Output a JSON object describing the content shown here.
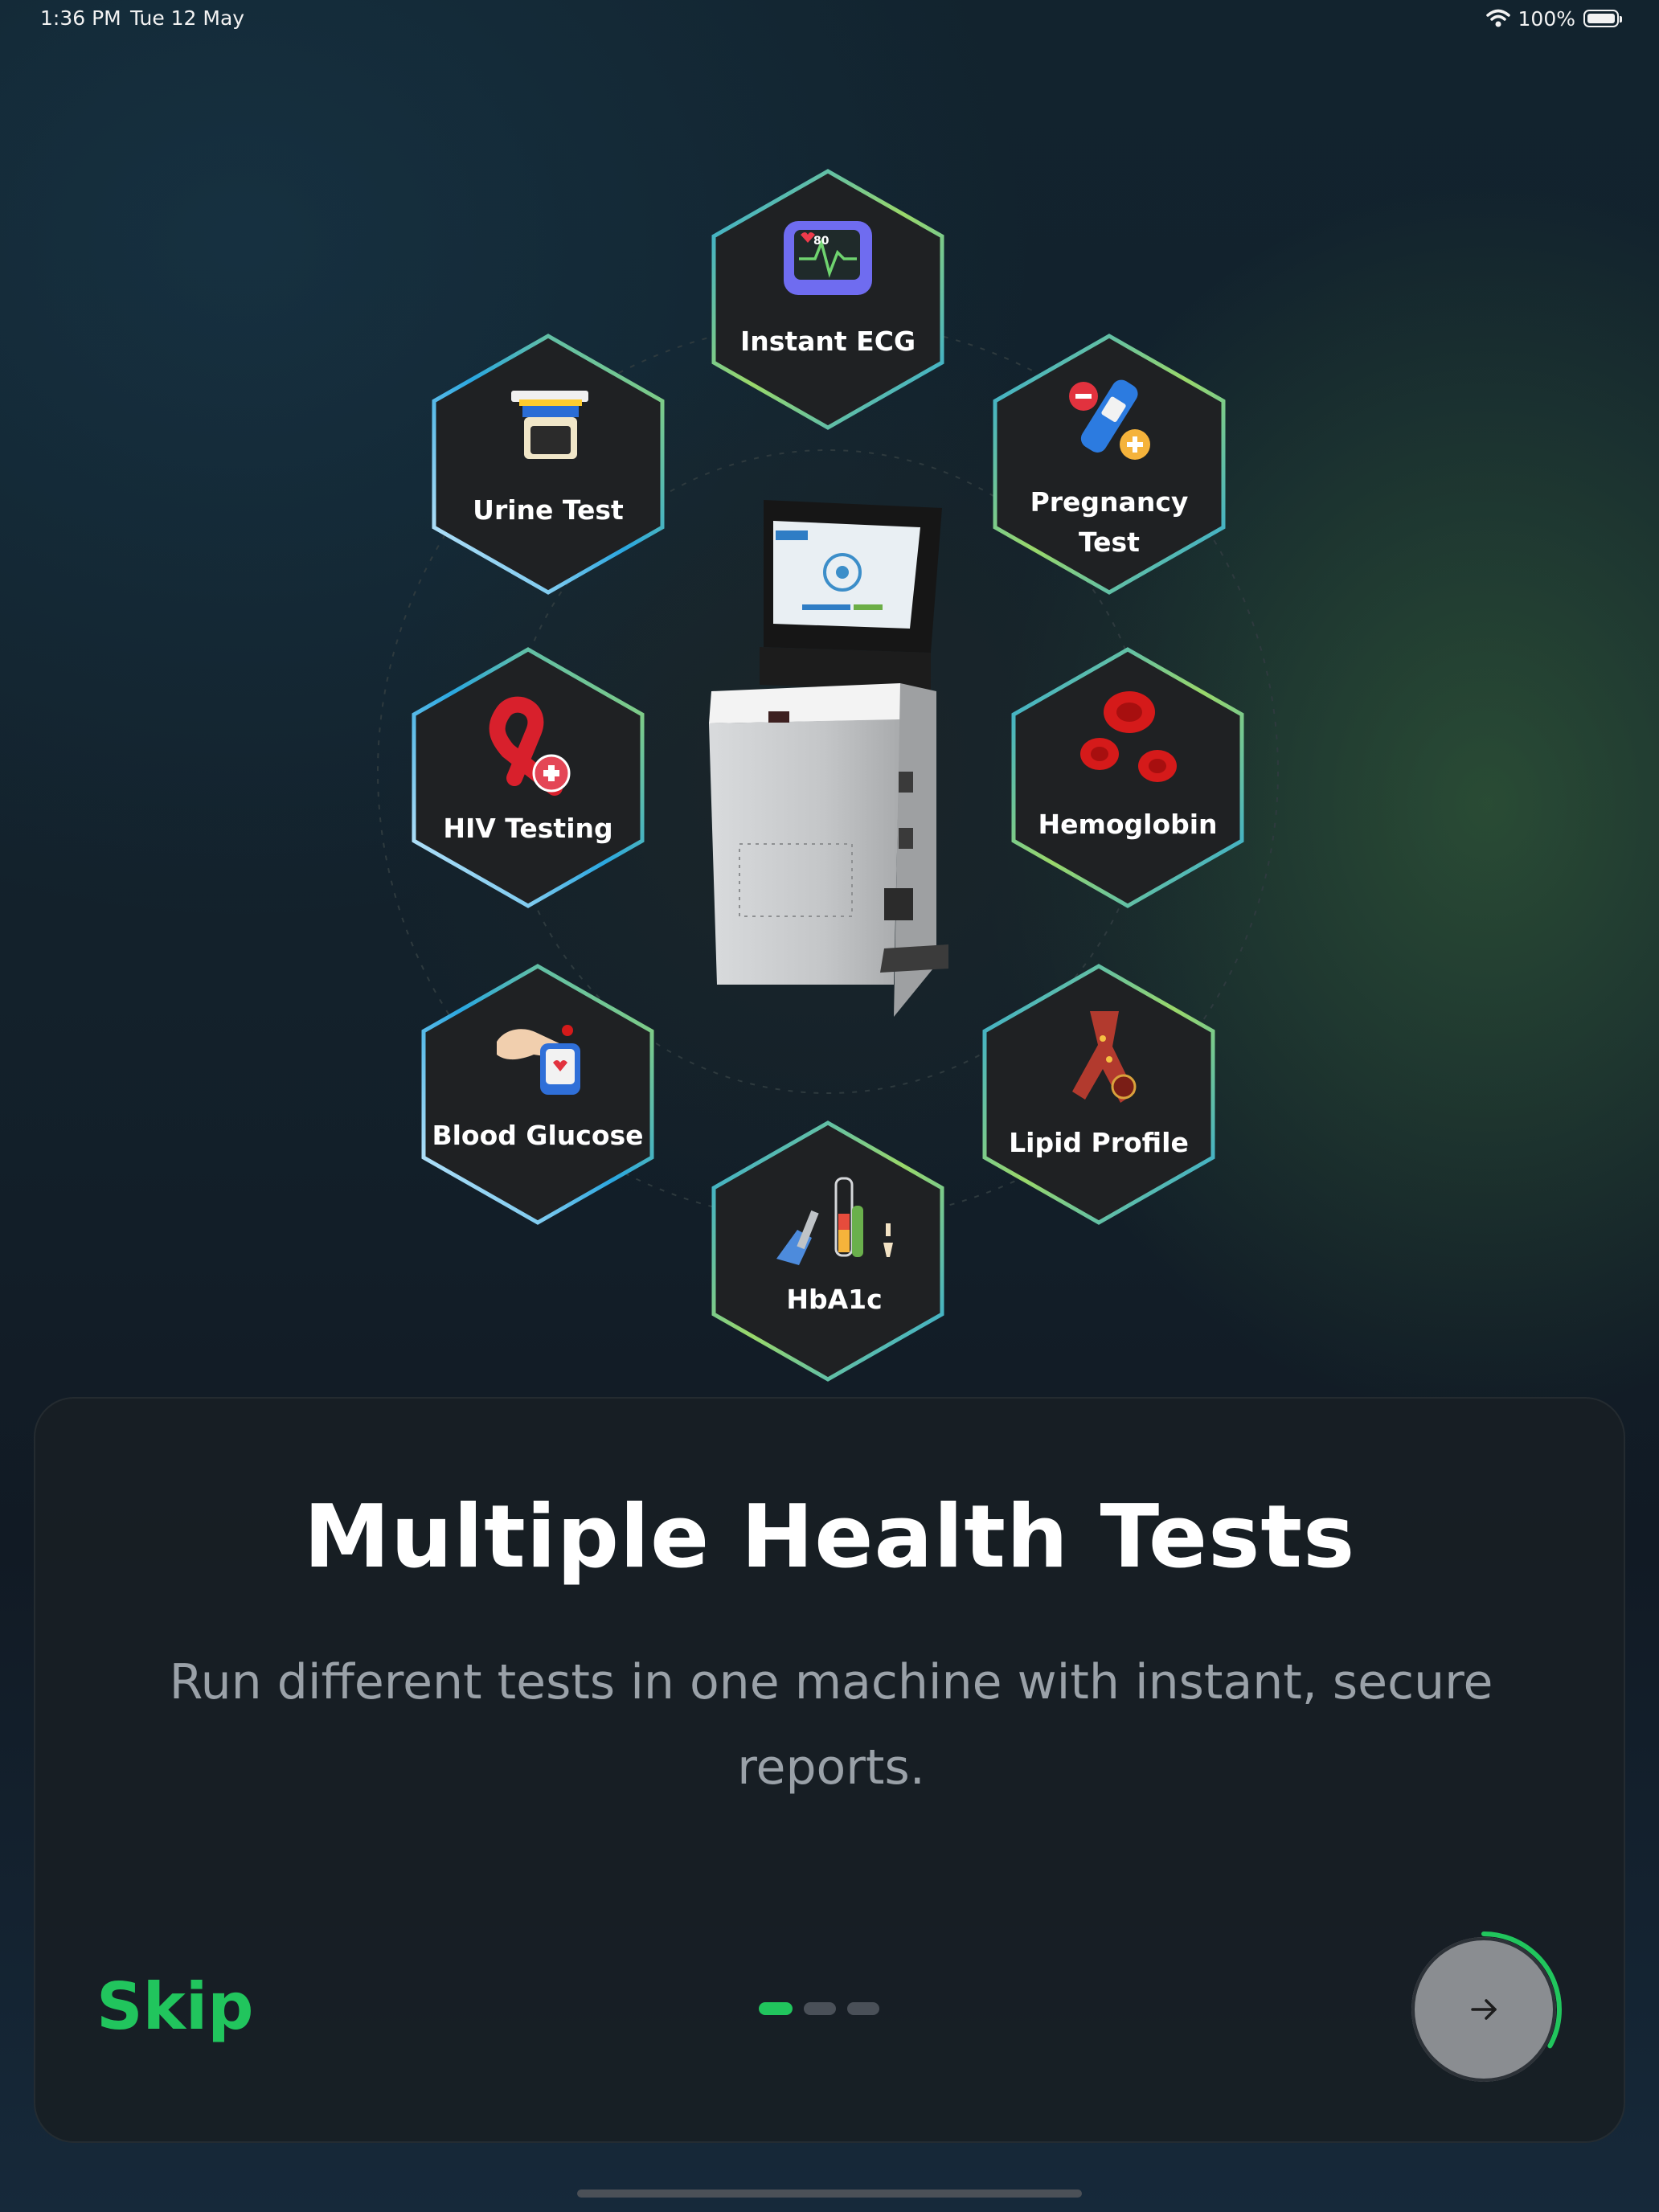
{
  "status_bar": {
    "time": "1:36 PM",
    "date": "Tue 12 May",
    "battery": "100%",
    "icons": [
      "wifi-icon",
      "battery-icon"
    ]
  },
  "tests": [
    {
      "label": "Instant ECG",
      "icon": "ecg-monitor-icon"
    },
    {
      "label": "Urine Test",
      "icon": "urine-cup-icon"
    },
    {
      "label_line1": "Pregnancy",
      "label_line2": "Test",
      "icon": "pregnancy-test-icon"
    },
    {
      "label": "HIV Testing",
      "icon": "awareness-ribbon-icon"
    },
    {
      "label": "Hemoglobin",
      "icon": "red-blood-cells-icon"
    },
    {
      "label": "Blood Glucose",
      "icon": "glucometer-icon"
    },
    {
      "label": "Lipid Profile",
      "icon": "artery-icon"
    },
    {
      "label": "HbA1c",
      "icon": "test-tubes-icon"
    }
  ],
  "onboarding": {
    "title": "Multiple Health Tests",
    "subtitle": "Run different tests in one machine with instant, secure reports.",
    "skip_label": "Skip",
    "page_count": 3,
    "current_page": 1,
    "progress": 0.33
  },
  "colors": {
    "accent": "#21c55d",
    "hex_blue": "#2aa7e0",
    "hex_green": "#9ad86a",
    "card_bg": "#181e24"
  }
}
